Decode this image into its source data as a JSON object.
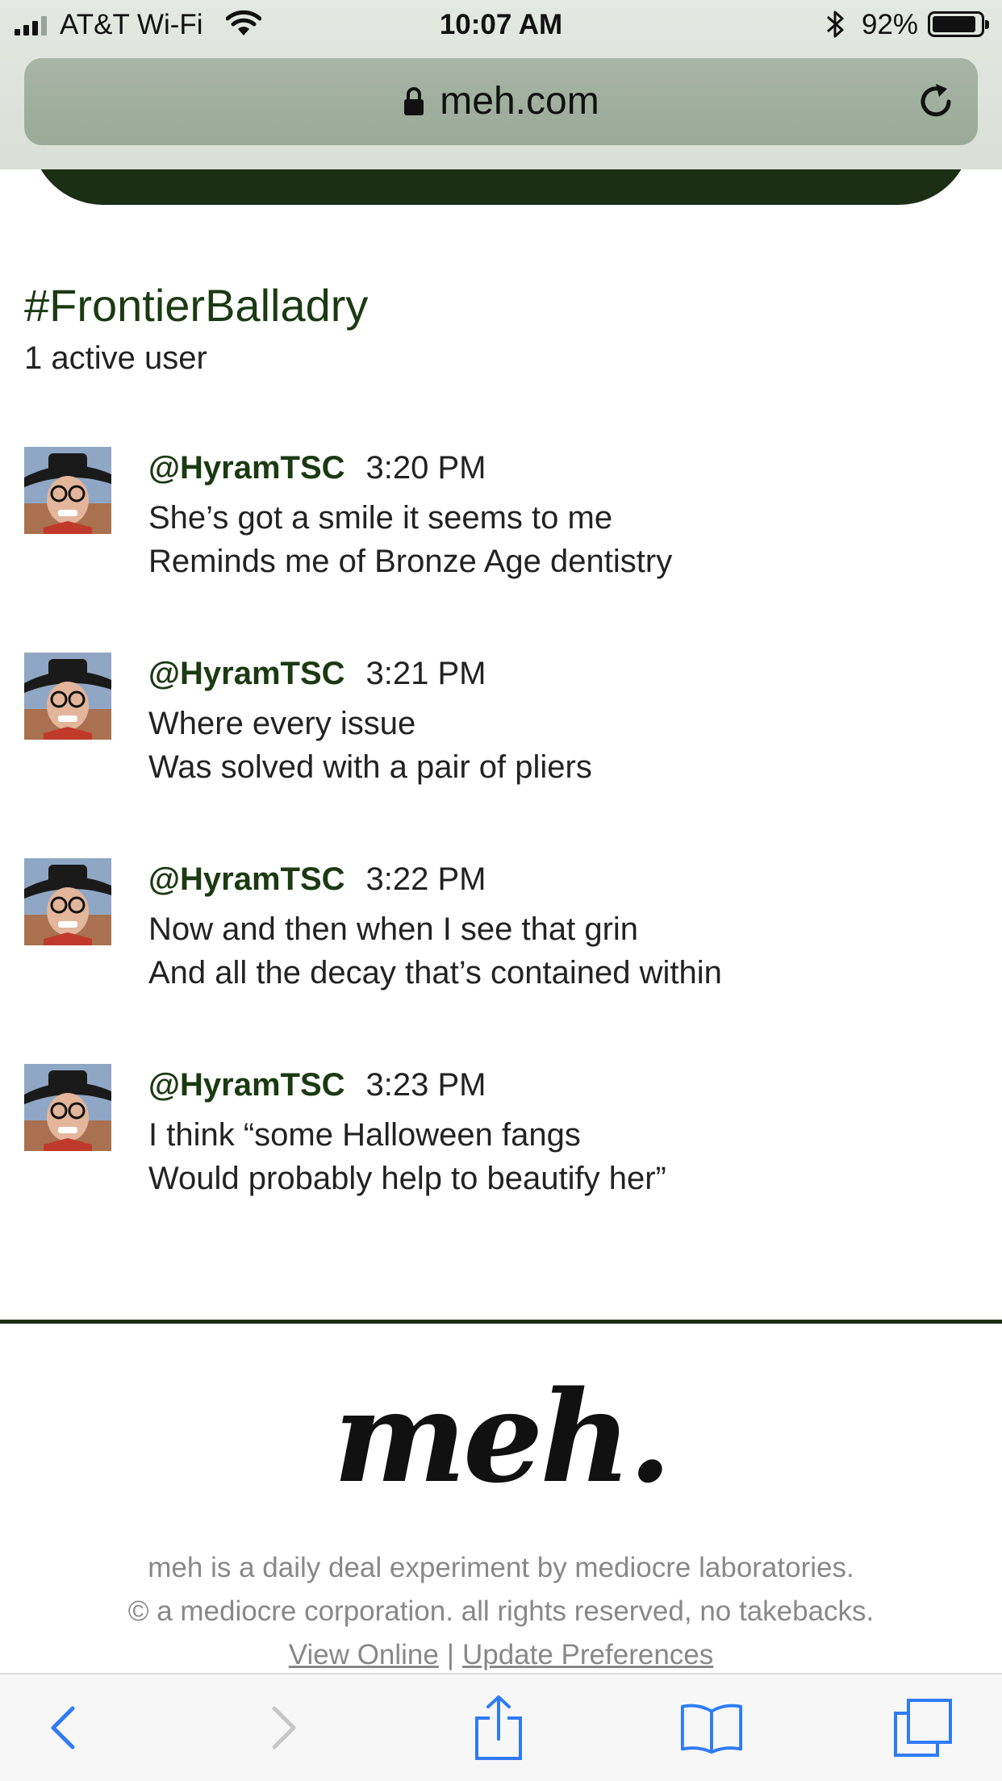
{
  "status_bar": {
    "carrier": "AT&T Wi-Fi",
    "time": "10:07 AM",
    "battery_percent": "92%",
    "battery_level": 0.92
  },
  "browser": {
    "url": "meh.com"
  },
  "channel": {
    "title": "#FrontierBalladry",
    "active_users": "1 active user"
  },
  "messages": [
    {
      "user": "@HyramTSC",
      "time": "3:20 PM",
      "lines": [
        "She’s got a smile it seems to me",
        "Reminds me of Bronze Age dentistry"
      ]
    },
    {
      "user": "@HyramTSC",
      "time": "3:21 PM",
      "lines": [
        "Where every issue",
        "Was solved with a pair of pliers"
      ]
    },
    {
      "user": "@HyramTSC",
      "time": "3:22 PM",
      "lines": [
        "Now and then when I see that grin",
        "And all the decay that’s contained within"
      ]
    },
    {
      "user": "@HyramTSC",
      "time": "3:23 PM",
      "lines": [
        "I think “some Halloween fangs",
        "Would probably help to beautify her”"
      ]
    }
  ],
  "footer": {
    "logo": "meh.",
    "tagline": "meh is a daily deal experiment by mediocre laboratories.",
    "copyright": "© a mediocre corporation. all rights reserved, no takebacks.",
    "view_online": "View Online",
    "separator": "|",
    "update_preferences": "Update Preferences"
  },
  "toolbar": {
    "icons": [
      "back-icon",
      "forward-icon",
      "share-icon",
      "bookmarks-icon",
      "tabs-icon"
    ]
  },
  "colors": {
    "brand_green": "#1b3a12",
    "header_band": "#1b2f15",
    "link_blue": "#2f7bf6"
  }
}
